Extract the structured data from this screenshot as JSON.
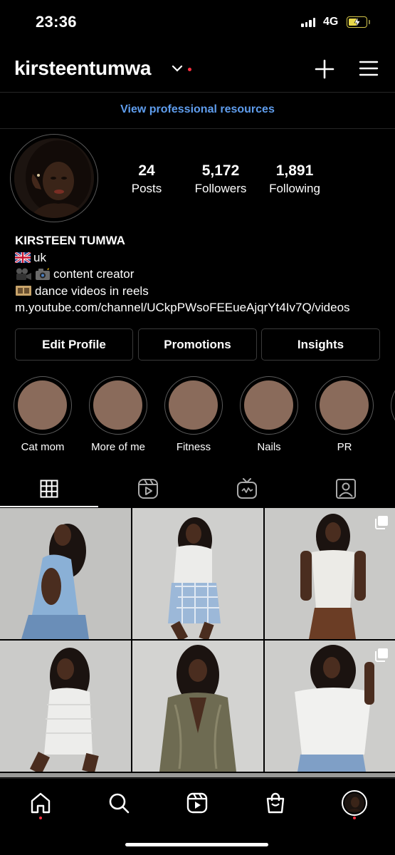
{
  "status_bar": {
    "time": "23:36",
    "network": "4G"
  },
  "header": {
    "username": "kirsteentumwa"
  },
  "pro_link": "View professional resources",
  "stats": [
    {
      "value": "24",
      "label": "Posts"
    },
    {
      "value": "5,172",
      "label": "Followers"
    },
    {
      "value": "1,891",
      "label": "Following"
    }
  ],
  "bio": {
    "name": "KIRSTEEN TUMWA",
    "line1": "uk",
    "line2": "content creator",
    "line3": "dance videos in reels",
    "link": "m.youtube.com/channel/UCkpPWsoFEEueAjqrYt4Iv7Q/videos",
    "icons": [
      "uk-flag-emoji",
      "video-camera-emoji",
      "camera-flash-emoji",
      "film-frames-emoji"
    ]
  },
  "buttons": {
    "edit_profile": "Edit Profile",
    "promotions": "Promotions",
    "insights": "Insights"
  },
  "highlights": [
    {
      "label": "Cat mom"
    },
    {
      "label": "More of me"
    },
    {
      "label": "Fitness"
    },
    {
      "label": "Nails"
    },
    {
      "label": "PR"
    }
  ],
  "tabs": [
    "grid-icon",
    "reels-icon",
    "igtv-icon",
    "tagged-icon"
  ],
  "posts": [
    {
      "outfit": "blue backless top, denim jeans",
      "carousel": false
    },
    {
      "outfit": "white turtleneck, blue plaid skirt",
      "carousel": false
    },
    {
      "outfit": "white corset, brown leather pants",
      "carousel": true
    },
    {
      "outfit": "white ruched mini dress",
      "carousel": false
    },
    {
      "outfit": "olive satin blazer",
      "carousel": false
    },
    {
      "outfit": "white off-shoulder top, jeans",
      "carousel": true
    }
  ],
  "nav": [
    "home-icon",
    "search-icon",
    "reels-icon",
    "shop-icon",
    "profile-avatar"
  ],
  "colors": {
    "accent_link": "#5f9ded",
    "notification": "#ff3040",
    "highlight_cover": "#8a6b5b",
    "border": "#262626"
  }
}
